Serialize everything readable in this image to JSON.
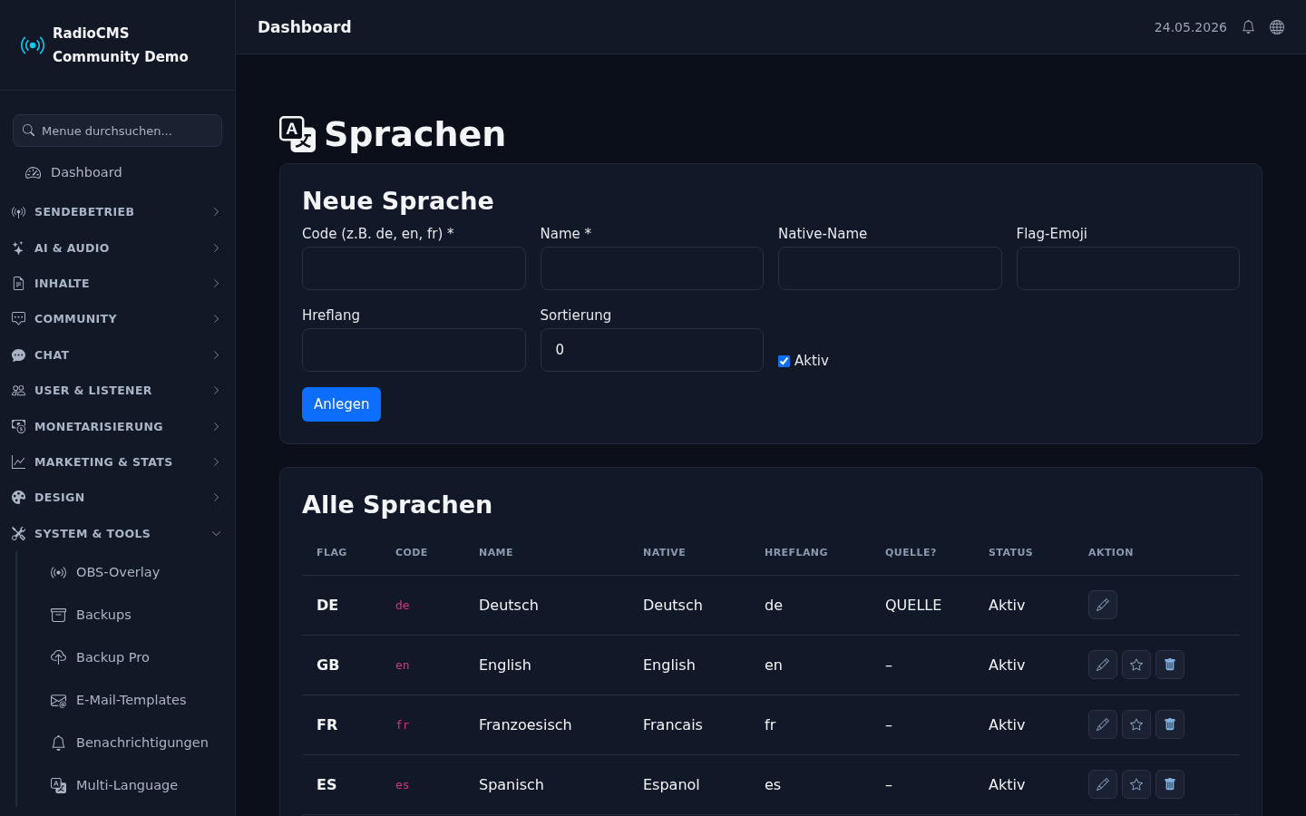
{
  "sidebar": {
    "brand": "RadioCMS Community Demo",
    "search": {
      "placeholder": "Menue durchsuchen..."
    },
    "dashboard_link": "Dashboard",
    "sections": [
      {
        "label": "SENDEBETRIEB",
        "expanded": false
      },
      {
        "label": "AI & AUDIO",
        "expanded": false
      },
      {
        "label": "INHALTE",
        "expanded": false
      },
      {
        "label": "COMMUNITY",
        "expanded": false
      },
      {
        "label": "CHAT",
        "expanded": false
      },
      {
        "label": "USER & LISTENER",
        "expanded": false
      },
      {
        "label": "MONETARISIERUNG",
        "expanded": false
      },
      {
        "label": "MARKETING & STATS",
        "expanded": false
      },
      {
        "label": "DESIGN",
        "expanded": false
      },
      {
        "label": "SYSTEM & TOOLS",
        "expanded": true,
        "children": [
          {
            "label": "OBS-Overlay"
          },
          {
            "label": "Backups"
          },
          {
            "label": "Backup Pro"
          },
          {
            "label": "E-Mail-Templates"
          },
          {
            "label": "Benachrichtigungen"
          },
          {
            "label": "Multi-Language"
          }
        ]
      }
    ]
  },
  "topbar": {
    "title": "Dashboard",
    "date": "24.05.2026"
  },
  "page_title": "Sprachen",
  "new_language_form": {
    "title": "Neue Sprache",
    "fields": [
      {
        "label": "Code (z.B. de, en, fr) *"
      },
      {
        "label": "Name *"
      },
      {
        "label": "Native-Name"
      },
      {
        "label": "Flag-Emoji"
      },
      {
        "label": "Hreflang"
      },
      {
        "label": "Sortierung",
        "value": "0"
      }
    ],
    "active_checkbox": {
      "label": "Aktiv",
      "checked": true
    },
    "submit_button": "Anlegen"
  },
  "languages_table": {
    "title": "Alle Sprachen",
    "columns": [
      "FLAG",
      "CODE",
      "NAME",
      "NATIVE",
      "HREFLANG",
      "QUELLE?",
      "STATUS",
      "AKTION"
    ],
    "rows": [
      {
        "flag": "DE",
        "code": "de",
        "name": "Deutsch",
        "native": "Deutsch",
        "hreflang": "de",
        "source": "QUELLE",
        "status": "Aktiv",
        "actions": [
          {
            "kind": "edit"
          }
        ]
      },
      {
        "flag": "GB",
        "code": "en",
        "name": "English",
        "native": "English",
        "hreflang": "en",
        "source": "–",
        "status": "Aktiv",
        "actions": [
          {
            "kind": "edit"
          },
          {
            "kind": "star"
          },
          {
            "kind": "delete"
          }
        ]
      },
      {
        "flag": "FR",
        "code": "fr",
        "name": "Franzoesisch",
        "native": "Francais",
        "hreflang": "fr",
        "source": "–",
        "status": "Aktiv",
        "actions": [
          {
            "kind": "edit"
          },
          {
            "kind": "star"
          },
          {
            "kind": "delete"
          }
        ]
      },
      {
        "flag": "ES",
        "code": "es",
        "name": "Spanisch",
        "native": "Espanol",
        "hreflang": "es",
        "source": "–",
        "status": "Aktiv",
        "actions": [
          {
            "kind": "edit"
          },
          {
            "kind": "star"
          },
          {
            "kind": "delete"
          }
        ]
      }
    ]
  }
}
